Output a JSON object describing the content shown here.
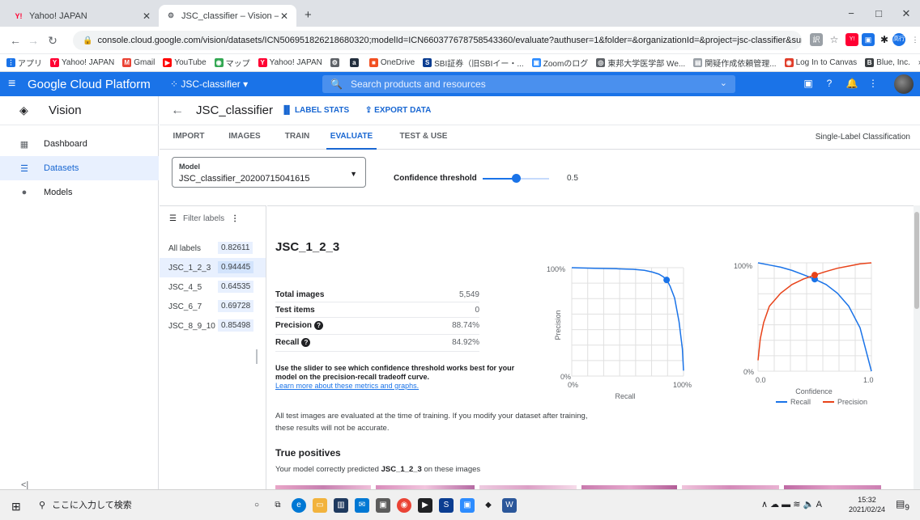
{
  "browser": {
    "tabs": [
      {
        "title": "Yahoo! JAPAN",
        "favicon": "Y!"
      },
      {
        "title": "JSC_classifier – Vision – JSC-class",
        "favicon": "⚙"
      }
    ],
    "new_tab": "+",
    "url": "console.cloud.google.com/vision/datasets/ICN50695182621868032​0;modelId=ICN6603776787585433​60/evaluate?authuser=1&folder=&organizationId=&project=jsc-classifier&suppo...",
    "bookmarks": [
      "アプリ",
      "Yahoo! JAPAN",
      "Gmail",
      "YouTube",
      "マップ",
      "Yahoo! JAPAN",
      "",
      "a",
      "OneDrive",
      "SBI証券（旧SBIイー・...",
      "Zoomのログ",
      "東邦大学医学部 We...",
      "関疑作成依頼管理...",
      "Log In to Canvas",
      "Blue, Inc."
    ],
    "bookmarks_more": "»",
    "profile": "高行"
  },
  "gcp": {
    "brand": "Google Cloud Platform",
    "project": "JSC-classifier",
    "search_placeholder": "Search products and resources"
  },
  "nav": {
    "product": "Vision",
    "items": [
      {
        "label": "Dashboard",
        "icon": "dashboard-icon"
      },
      {
        "label": "Datasets",
        "icon": "datasets-icon"
      },
      {
        "label": "Models",
        "icon": "models-icon"
      }
    ],
    "collapse": "<|"
  },
  "dataset": {
    "name": "JSC_classifier",
    "label_stats": "LABEL STATS",
    "export_data": "EXPORT DATA",
    "tabs": [
      "IMPORT",
      "IMAGES",
      "TRAIN",
      "EVALUATE",
      "TEST & USE"
    ],
    "active_tab": "EVALUATE",
    "classification": "Single-Label Classification"
  },
  "model": {
    "label": "Model",
    "value": "JSC_classifier_20200715041615",
    "confidence_label": "Confidence threshold",
    "confidence_value": "0.5",
    "confidence_fraction": 0.5
  },
  "labels": {
    "filter": "Filter labels",
    "rows": [
      {
        "name": "All labels",
        "score": "0.82611"
      },
      {
        "name": "JSC_1_2_3",
        "score": "0.94445"
      },
      {
        "name": "JSC_4_5",
        "score": "0.64535"
      },
      {
        "name": "JSC_6_7",
        "score": "0.69728"
      },
      {
        "name": "JSC_8_9_10",
        "score": "0.85498"
      }
    ]
  },
  "detail": {
    "title": "JSC_1_2_3",
    "stats": [
      {
        "key": "Total images",
        "value": "5,549"
      },
      {
        "key": "Test items",
        "value": "0"
      },
      {
        "key": "Precision",
        "value": "88.74%"
      },
      {
        "key": "Recall",
        "value": "84.92%"
      }
    ],
    "slider_note": "Use the slider to see which confidence threshold works best for your model on the precision-recall tradeoff curve.",
    "learn_more": "Learn more about these metrics and graphs.",
    "eval_note": "All test images are evaluated at the time of training. If you modify your dataset after training, these results will not be accurate.",
    "tp_title": "True positives",
    "tp_desc_pre": "Your model correctly predicted",
    "tp_desc_label": "JSC_1_2_3",
    "tp_desc_post": "on these images"
  },
  "chart_data": [
    {
      "type": "line",
      "title": "",
      "xlabel": "Recall",
      "ylabel": "Precision",
      "xlim": [
        0,
        1
      ],
      "ylim": [
        0,
        1
      ],
      "x_ticks": [
        "0%",
        "100%"
      ],
      "y_ticks": [
        "0%",
        "100%"
      ],
      "series": [
        {
          "x": [
            0.0,
            0.2,
            0.4,
            0.55,
            0.65,
            0.72,
            0.78,
            0.82,
            0.849,
            0.88,
            0.92,
            0.96,
            0.99,
            1.0
          ],
          "y": [
            1.0,
            0.995,
            0.99,
            0.985,
            0.975,
            0.96,
            0.94,
            0.915,
            0.887,
            0.83,
            0.72,
            0.5,
            0.25,
            0.05
          ]
        }
      ],
      "marker": {
        "x": 0.849,
        "y": 0.887
      },
      "color": "#1a73e8"
    },
    {
      "type": "line",
      "title": "",
      "xlabel": "Confidence",
      "ylabel": "",
      "xlim": [
        0,
        1
      ],
      "ylim": [
        0,
        1
      ],
      "x_ticks": [
        "0.0",
        "1.0"
      ],
      "y_ticks": [
        "0%",
        "100%"
      ],
      "series": [
        {
          "name": "Recall",
          "color": "#1a73e8",
          "x": [
            0.0,
            0.1,
            0.2,
            0.3,
            0.4,
            0.5,
            0.6,
            0.7,
            0.8,
            0.9,
            0.95,
            1.0
          ],
          "y": [
            1.0,
            0.98,
            0.96,
            0.93,
            0.89,
            0.849,
            0.8,
            0.72,
            0.6,
            0.4,
            0.2,
            0.0
          ]
        },
        {
          "name": "Precision",
          "color": "#e8431a",
          "x": [
            0.0,
            0.02,
            0.05,
            0.1,
            0.2,
            0.3,
            0.4,
            0.5,
            0.6,
            0.7,
            0.8,
            0.9,
            1.0
          ],
          "y": [
            0.1,
            0.3,
            0.45,
            0.6,
            0.72,
            0.8,
            0.85,
            0.887,
            0.92,
            0.95,
            0.97,
            0.99,
            1.0
          ]
        }
      ],
      "marker": {
        "x": 0.5,
        "recall": 0.849,
        "precision": 0.887
      },
      "legend": "bottom"
    }
  ],
  "taskbar": {
    "search": "ここに入力して検索",
    "time": "15:32",
    "date": "2021/02/24",
    "ime": "A",
    "notifications": "9"
  },
  "colors": {
    "accent": "#1a73e8",
    "precision": "#e8431a"
  }
}
